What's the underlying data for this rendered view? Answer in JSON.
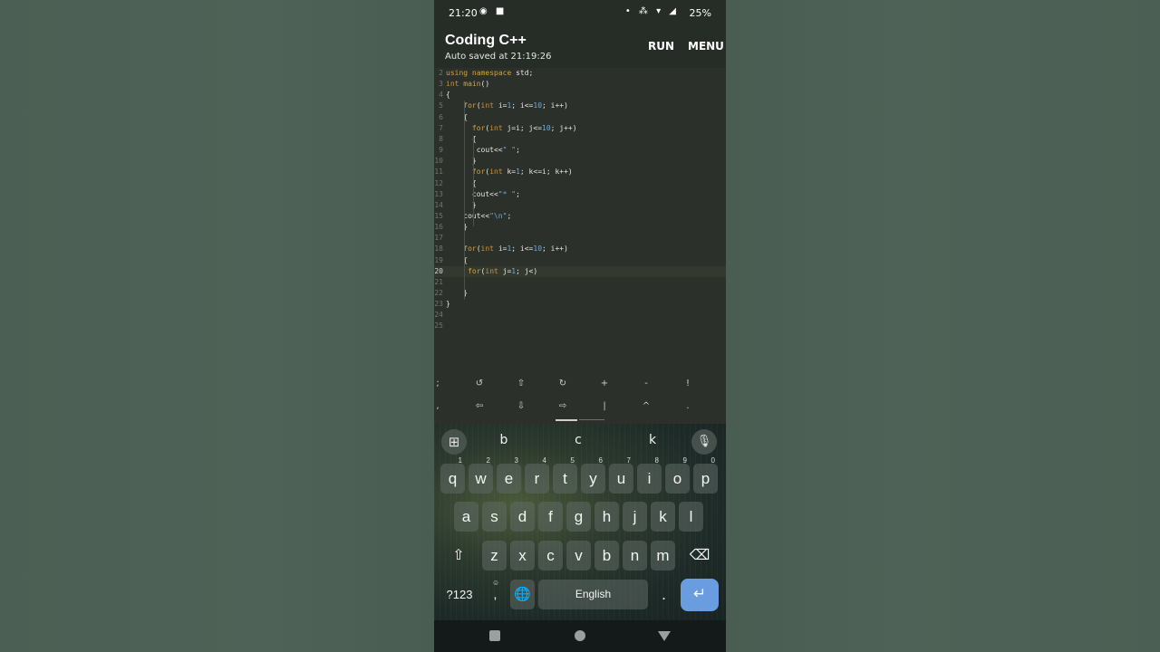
{
  "status_bar": {
    "time": "21:20",
    "left_icons": "◉ ■",
    "right_icons": "• ⁂ ▾ ◢",
    "battery": "25%"
  },
  "app": {
    "title": "Coding C++",
    "subtitle": "Auto saved at 21:19:26",
    "run_label": "RUN",
    "menu_label": "MENU"
  },
  "editor": {
    "active_line": "20",
    "lines": [
      {
        "n": "2",
        "t": "using namespace std;"
      },
      {
        "n": "3",
        "t": "int main()"
      },
      {
        "n": "4",
        "t": "{"
      },
      {
        "n": "5",
        "t": "    for(int i=1; i<=10; i++)"
      },
      {
        "n": "6",
        "t": "    {"
      },
      {
        "n": "7",
        "t": "      for(int j=i; j<=10; j++)"
      },
      {
        "n": "8",
        "t": "      {"
      },
      {
        "n": "9",
        "t": "       cout<<\" \";"
      },
      {
        "n": "10",
        "t": "      }"
      },
      {
        "n": "11",
        "t": "      for(int k=1; k<=i; k++)"
      },
      {
        "n": "12",
        "t": "      {"
      },
      {
        "n": "13",
        "t": "      cout<<\"* \";"
      },
      {
        "n": "14",
        "t": "      }"
      },
      {
        "n": "15",
        "t": "    cout<<\"\\n\";"
      },
      {
        "n": "16",
        "t": "    }"
      },
      {
        "n": "17",
        "t": ""
      },
      {
        "n": "18",
        "t": "    for(int i=1; i<=10; i++)"
      },
      {
        "n": "19",
        "t": "    {"
      },
      {
        "n": "20",
        "t": "     for(int j=1; j<)"
      },
      {
        "n": "21",
        "t": ""
      },
      {
        "n": "22",
        "t": "    }"
      },
      {
        "n": "23",
        "t": "}"
      },
      {
        "n": "24",
        "t": ""
      },
      {
        "n": "25",
        "t": ""
      }
    ]
  },
  "extra_keys": {
    "row1": [
      ";",
      "↺",
      "⇧",
      "↻",
      "+",
      "-",
      "!"
    ],
    "row2": [
      ",",
      "⇦",
      "⇩",
      "⇨",
      "|",
      "^",
      "."
    ]
  },
  "keyboard": {
    "suggestions": [
      "b",
      "c",
      "k"
    ],
    "row1": [
      {
        "k": "q",
        "h": "1"
      },
      {
        "k": "w",
        "h": "2"
      },
      {
        "k": "e",
        "h": "3"
      },
      {
        "k": "r",
        "h": "4"
      },
      {
        "k": "t",
        "h": "5"
      },
      {
        "k": "y",
        "h": "6"
      },
      {
        "k": "u",
        "h": "7"
      },
      {
        "k": "i",
        "h": "8"
      },
      {
        "k": "o",
        "h": "9"
      },
      {
        "k": "p",
        "h": "0"
      }
    ],
    "row2": [
      "a",
      "s",
      "d",
      "f",
      "g",
      "h",
      "j",
      "k",
      "l"
    ],
    "row3": [
      "z",
      "x",
      "c",
      "v",
      "b",
      "n",
      "m"
    ],
    "symbols_label": "?123",
    "comma_label": ",",
    "emoji_hint": "☺",
    "space_label": "English",
    "period_label": ".",
    "shift_glyph": "⇧",
    "backspace_glyph": "⌫",
    "globe_glyph": "🌐",
    "enter_glyph": "↵",
    "grid_glyph": "⊞",
    "mic_glyph": "🎙"
  },
  "icons": {
    "back": "square",
    "home": "circle",
    "recents": "triangle"
  }
}
